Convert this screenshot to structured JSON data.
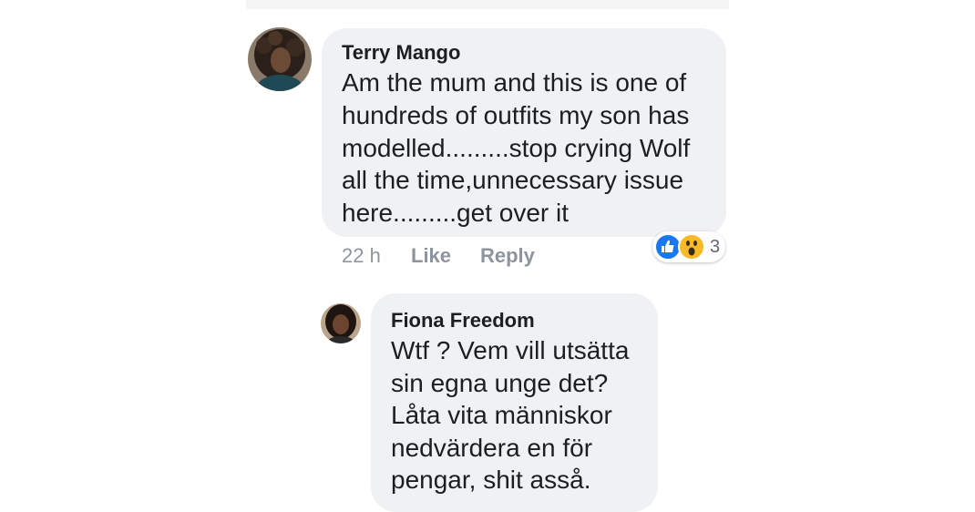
{
  "comments": [
    {
      "author": "Terry Mango",
      "lines": [
        "Am the mum and this is one of",
        "hundreds of outfits my son has",
        "modelled.........stop crying Wolf",
        "all the time,unnecessary issue",
        "here.........get over it"
      ],
      "time": "22 h",
      "like_label": "Like",
      "reply_label": "Reply",
      "reactions": {
        "icons": [
          "like-icon",
          "wow-icon"
        ],
        "count": "3"
      }
    },
    {
      "author": "Fiona Freedom",
      "lines": [
        "Wtf ? Vem vill utsätta",
        "sin egna unge det?",
        "Låta vita människor",
        "nedvärdera en för",
        "pengar, shit asså."
      ]
    }
  ],
  "colors": {
    "bubble": "#f0f1f3",
    "text": "#1c1e21",
    "meta": "#90949c",
    "like_blue": "#1877f2",
    "wow_yellow": "#f7b928"
  }
}
